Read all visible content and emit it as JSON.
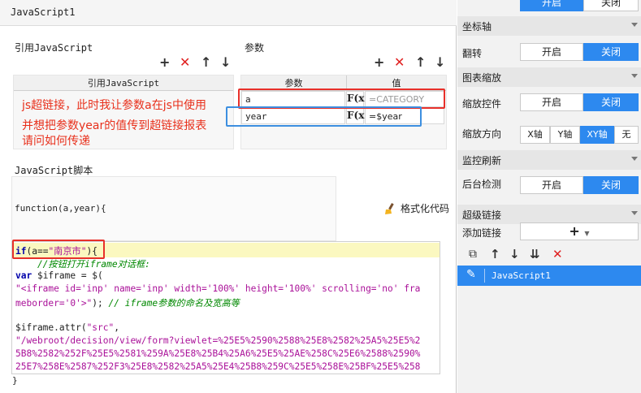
{
  "dialog": {
    "title": "JavaScript1",
    "ref_js": {
      "label": "引用JavaScript",
      "column": "引用JavaScript"
    },
    "params": {
      "label": "参数",
      "col_name": "参数",
      "col_value": "值",
      "rows": [
        {
          "name": "a",
          "fx": "F(x)",
          "value": "=CATEGORY"
        },
        {
          "name": "year",
          "fx": "F(x)",
          "value": "=$year"
        }
      ]
    },
    "annotation_lines": [
      "js超链接，此时我让参数a在js中使用",
      "并想把参数year的值传到超链接报表",
      "请问如何传递"
    ],
    "script_label": "JavaScript脚本",
    "function_sig": "function(a,year){",
    "format_code": "格式化代码",
    "code": {
      "l1_kw": "if",
      "l1_a": "(a==",
      "l1_str": "\"南京市\"",
      "l1_b": "){",
      "l2_cmt": "    //按钮打开iframe对话框:",
      "l3_kw": "var",
      "l3_rest": " $iframe = $(",
      "l4_str": "\"<iframe id='inp' name='inp' width='100%' height='100%' scrolling='no' fra",
      "l5_str": "meborder='0'>\"",
      "l5_b": "); ",
      "l5_cmt": "// iframe参数的命名及宽高等",
      "l6": "",
      "l7_a": "$iframe.attr(",
      "l7_str": "\"src\"",
      "l7_b": ",",
      "l8_str": "\"/webroot/decision/view/form?viewlet=%25E5%2590%2588%25E8%2582%25A5%25E5%2",
      "l9_str": "5B8%2582%252F%25E5%2581%259A%25E8%25B4%25A6%25E5%25AE%258C%25E6%2588%2590%",
      "l10_str": "25E7%258E%2587%252F3%25E8%2582%25A5%25E4%25B8%259C%25E5%258E%25BF%25E5%258",
      "closing": "}"
    }
  },
  "settings": {
    "top_seg": [
      "开启",
      "关闭"
    ],
    "axis_header": "坐标轴",
    "flip_label": "翻转",
    "flip_options": [
      "开启",
      "关闭"
    ],
    "zoom_header": "图表缩放",
    "zoom_ctrl_label": "缩放控件",
    "zoom_ctrl_options": [
      "开启",
      "关闭"
    ],
    "zoom_dir_label": "缩放方向",
    "zoom_dir_options": [
      "X轴",
      "Y轴",
      "XY轴",
      "无"
    ],
    "monitor_header": "监控刷新",
    "backend_label": "后台检测",
    "backend_options": [
      "开启",
      "关闭"
    ],
    "hyper_header": "超级链接",
    "add_link_label": "添加链接",
    "add_icon": "+",
    "link_items": [
      "JavaScript1"
    ],
    "accent": "#2d89ef"
  }
}
